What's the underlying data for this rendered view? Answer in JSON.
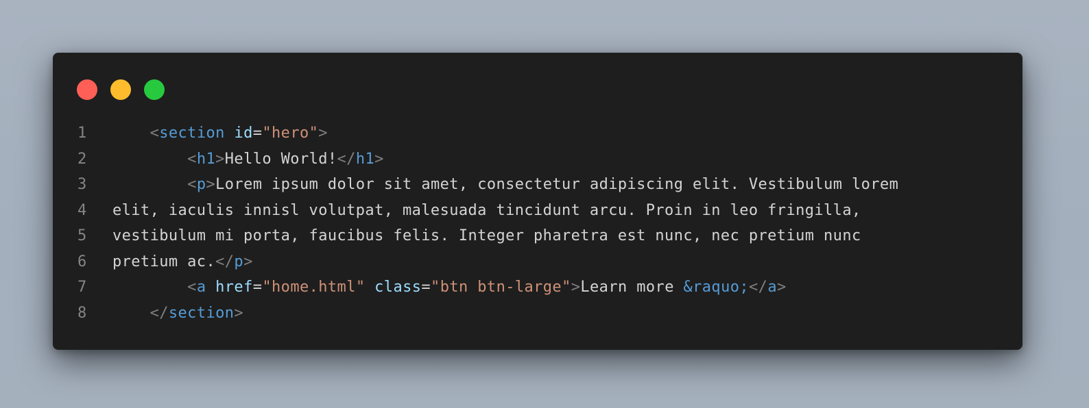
{
  "window": {
    "controls": [
      {
        "name": "close",
        "color": "#ff5f56"
      },
      {
        "name": "minimize",
        "color": "#ffbd2e"
      },
      {
        "name": "maximize",
        "color": "#27c93f"
      }
    ]
  },
  "theme": {
    "background": "#1e1e1e",
    "page_background": "#a9b3c0",
    "line_number": "#858585",
    "punctuation": "#808080",
    "tag": "#569cd6",
    "attribute_name": "#9cdcfe",
    "attribute_value": "#ce9178",
    "text": "#d4d4d4"
  },
  "code": {
    "lines": [
      {
        "number": "1",
        "tokens": [
          {
            "t": "    ",
            "k": "txt"
          },
          {
            "t": "<",
            "k": "pun"
          },
          {
            "t": "section",
            "k": "tag"
          },
          {
            "t": " ",
            "k": "txt"
          },
          {
            "t": "id",
            "k": "atn"
          },
          {
            "t": "=",
            "k": "txt"
          },
          {
            "t": "\"hero\"",
            "k": "atv"
          },
          {
            "t": ">",
            "k": "pun"
          }
        ]
      },
      {
        "number": "2",
        "tokens": [
          {
            "t": "        ",
            "k": "txt"
          },
          {
            "t": "<",
            "k": "pun"
          },
          {
            "t": "h1",
            "k": "tag"
          },
          {
            "t": ">",
            "k": "pun"
          },
          {
            "t": "Hello World!",
            "k": "txt"
          },
          {
            "t": "</",
            "k": "pun"
          },
          {
            "t": "h1",
            "k": "tag"
          },
          {
            "t": ">",
            "k": "pun"
          }
        ]
      },
      {
        "number": "3",
        "tokens": [
          {
            "t": "        ",
            "k": "txt"
          },
          {
            "t": "<",
            "k": "pun"
          },
          {
            "t": "p",
            "k": "tag"
          },
          {
            "t": ">",
            "k": "pun"
          },
          {
            "t": "Lorem ipsum dolor sit amet, consectetur adipiscing elit. Vestibulum lorem",
            "k": "txt"
          }
        ]
      },
      {
        "number": "4",
        "tokens": [
          {
            "t": "elit, iaculis innisl volutpat, malesuada tincidunt arcu. Proin in leo fringilla,",
            "k": "txt"
          }
        ]
      },
      {
        "number": "5",
        "tokens": [
          {
            "t": "vestibulum mi porta, faucibus felis. Integer pharetra est nunc, nec pretium nunc",
            "k": "txt"
          }
        ]
      },
      {
        "number": "6",
        "tokens": [
          {
            "t": "pretium ac.",
            "k": "txt"
          },
          {
            "t": "</",
            "k": "pun"
          },
          {
            "t": "p",
            "k": "tag"
          },
          {
            "t": ">",
            "k": "pun"
          }
        ]
      },
      {
        "number": "7",
        "tokens": [
          {
            "t": "        ",
            "k": "txt"
          },
          {
            "t": "<",
            "k": "pun"
          },
          {
            "t": "a",
            "k": "tag"
          },
          {
            "t": " ",
            "k": "txt"
          },
          {
            "t": "href",
            "k": "atn"
          },
          {
            "t": "=",
            "k": "txt"
          },
          {
            "t": "\"home.html\"",
            "k": "atv"
          },
          {
            "t": " ",
            "k": "txt"
          },
          {
            "t": "class",
            "k": "atn"
          },
          {
            "t": "=",
            "k": "txt"
          },
          {
            "t": "\"btn btn-large\"",
            "k": "atv"
          },
          {
            "t": ">",
            "k": "pun"
          },
          {
            "t": "Learn more ",
            "k": "txt"
          },
          {
            "t": "&raquo;",
            "k": "ent"
          },
          {
            "t": "</",
            "k": "pun"
          },
          {
            "t": "a",
            "k": "tag"
          },
          {
            "t": ">",
            "k": "pun"
          }
        ]
      },
      {
        "number": "8",
        "tokens": [
          {
            "t": "    ",
            "k": "txt"
          },
          {
            "t": "</",
            "k": "pun"
          },
          {
            "t": "section",
            "k": "tag"
          },
          {
            "t": ">",
            "k": "pun"
          }
        ]
      }
    ]
  }
}
